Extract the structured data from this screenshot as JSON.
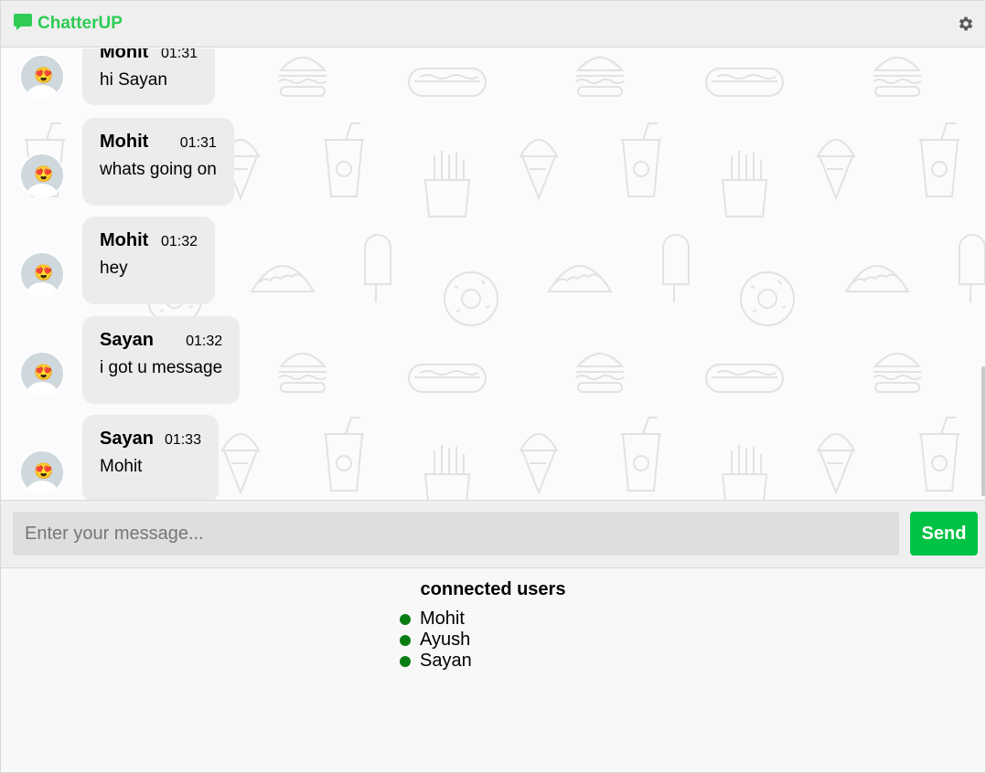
{
  "header": {
    "app_name": "ChatterUP",
    "logo_icon": "chat-bubble-icon",
    "settings_icon": "gear-icon",
    "brand_color": "#2ecc55"
  },
  "messages": [
    {
      "sender": "Mohit",
      "time": "01:31",
      "text": "hi Sayan"
    },
    {
      "sender": "Mohit",
      "time": "01:31",
      "text": "whats going on"
    },
    {
      "sender": "Mohit",
      "time": "01:32",
      "text": "hey"
    },
    {
      "sender": "Sayan",
      "time": "01:32",
      "text": "i got u message"
    },
    {
      "sender": "Sayan",
      "time": "01:33",
      "text": "Mohit"
    }
  ],
  "avatar": {
    "face": "😍"
  },
  "composer": {
    "placeholder": "Enter your message...",
    "value": "",
    "send_label": "Send",
    "send_color": "#00c244"
  },
  "connected": {
    "title": "connected users",
    "users": [
      "Mohit",
      "Ayush",
      "Sayan"
    ],
    "status_color": "#0a7d12"
  }
}
